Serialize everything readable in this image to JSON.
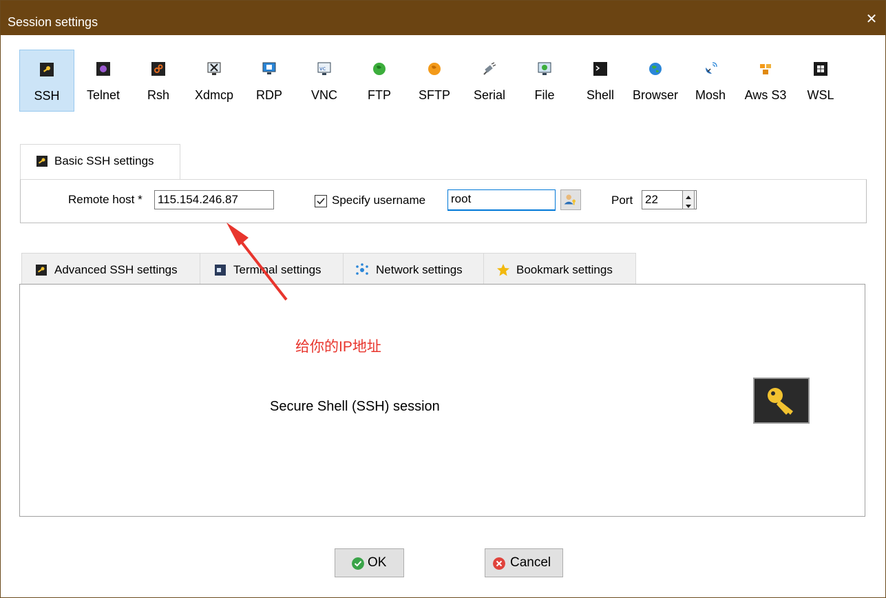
{
  "window": {
    "title": "Session settings",
    "close": "✕"
  },
  "protocols": [
    {
      "label": "SSH",
      "icon": "ssh-key-icon",
      "active": true
    },
    {
      "label": "Telnet",
      "icon": "telnet-icon"
    },
    {
      "label": "Rsh",
      "icon": "rsh-icon"
    },
    {
      "label": "Xdmcp",
      "icon": "xdmcp-icon"
    },
    {
      "label": "RDP",
      "icon": "rdp-icon"
    },
    {
      "label": "VNC",
      "icon": "vnc-icon"
    },
    {
      "label": "FTP",
      "icon": "ftp-globe-icon"
    },
    {
      "label": "SFTP",
      "icon": "sftp-globe-icon"
    },
    {
      "label": "Serial",
      "icon": "serial-plug-icon"
    },
    {
      "label": "File",
      "icon": "file-monitor-icon"
    },
    {
      "label": "Shell",
      "icon": "shell-terminal-icon"
    },
    {
      "label": "Browser",
      "icon": "browser-globe-icon"
    },
    {
      "label": "Mosh",
      "icon": "mosh-satellite-icon"
    },
    {
      "label": "Aws S3",
      "icon": "aws-s3-icon"
    },
    {
      "label": "WSL",
      "icon": "wsl-windows-icon"
    }
  ],
  "basic": {
    "tab_label": "Basic SSH settings",
    "remote_host_label": "Remote host *",
    "remote_host_value": "115.154.246.87",
    "specify_username_label": "Specify username",
    "specify_username_checked": true,
    "username_value": "root",
    "port_label": "Port",
    "port_value": "22"
  },
  "advanced_tabs": [
    {
      "label": "Advanced SSH settings",
      "icon": "ssh-key-icon"
    },
    {
      "label": "Terminal settings",
      "icon": "terminal-icon"
    },
    {
      "label": "Network settings",
      "icon": "network-icon"
    },
    {
      "label": "Bookmark settings",
      "icon": "star-icon"
    }
  ],
  "panel": {
    "session_text": "Secure Shell (SSH) session"
  },
  "annotation": {
    "text": "给你的IP地址",
    "color": "#e8352d"
  },
  "buttons": {
    "ok": "OK",
    "cancel": "Cancel"
  },
  "colors": {
    "titlebar": "#6b4412",
    "active_protocol": "#cce4f7",
    "focus": "#0078d7"
  }
}
